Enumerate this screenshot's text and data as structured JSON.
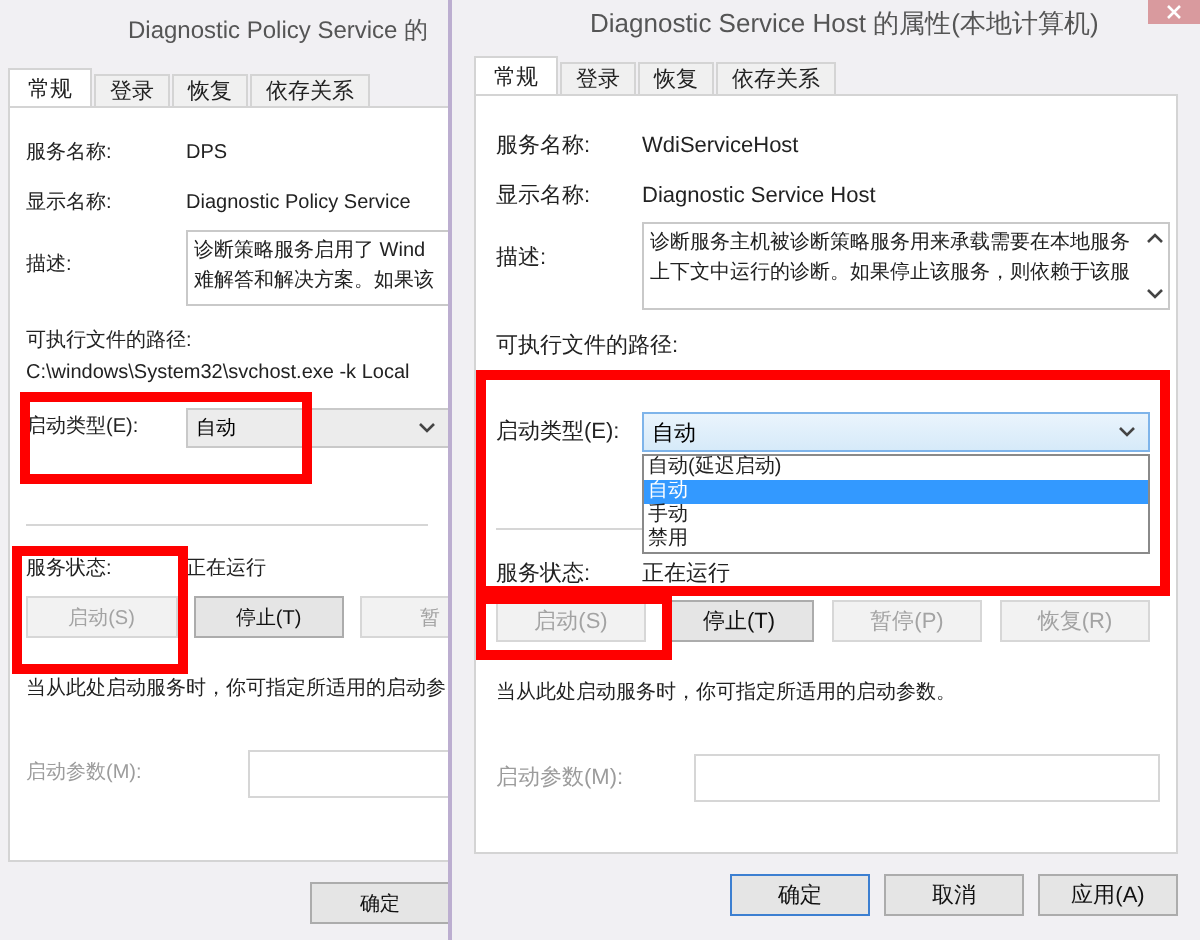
{
  "windows": [
    {
      "title": "Diagnostic Policy Service 的",
      "tabs": [
        {
          "label": "常规",
          "selected": true
        },
        {
          "label": "登录",
          "selected": false
        },
        {
          "label": "恢复",
          "selected": false
        },
        {
          "label": "依存关系",
          "selected": false
        }
      ],
      "service_name": {
        "label": "服务名称:",
        "value": "DPS"
      },
      "display_name": {
        "label": "显示名称:",
        "value": "Diagnostic Policy Service"
      },
      "description": {
        "label": "描述:",
        "lines": [
          "诊断策略服务启用了 Wind",
          "难解答和解决方案。如果该"
        ]
      },
      "path": {
        "label": "可执行文件的路径:",
        "value": "C:\\windows\\System32\\svchost.exe -k Local"
      },
      "startup_type": {
        "label": "启动类型(E):",
        "value": "自动",
        "expanded": false
      },
      "service_status": {
        "label": "服务状态:",
        "value": "正在运行"
      },
      "actions": [
        {
          "label": "启动(S)",
          "disabled": true
        },
        {
          "label": "停止(T)",
          "disabled": false
        },
        {
          "label": "暂",
          "disabled": true
        }
      ],
      "hint": "当从此处启动服务时，你可指定所适用的启动参",
      "parameters": {
        "label": "启动参数(M):",
        "disabled": true
      },
      "footer_buttons": [
        {
          "label": "确定",
          "default": false
        }
      ],
      "highlights": [
        {
          "kind": "startup"
        },
        {
          "kind": "status"
        }
      ]
    },
    {
      "title": "Diagnostic Service Host 的属性(本地计算机)",
      "close_button": true,
      "tabs": [
        {
          "label": "常规",
          "selected": true
        },
        {
          "label": "登录",
          "selected": false
        },
        {
          "label": "恢复",
          "selected": false
        },
        {
          "label": "依存关系",
          "selected": false
        }
      ],
      "service_name": {
        "label": "服务名称:",
        "value": "WdiServiceHost"
      },
      "display_name": {
        "label": "显示名称:",
        "value": "Diagnostic Service Host"
      },
      "description": {
        "label": "描述:",
        "lines": [
          "诊断服务主机被诊断策略服务用来承载需要在本地服务",
          "上下文中运行的诊断。如果停止该服务，则依赖于该服"
        ],
        "scrollbar": true
      },
      "path": {
        "label": "可执行文件的路径:"
      },
      "startup_type": {
        "label": "启动类型(E):",
        "value": "自动",
        "expanded": true,
        "options": [
          {
            "label": "自动(延迟启动)",
            "selected": false
          },
          {
            "label": "自动",
            "selected": true
          },
          {
            "label": "手动",
            "selected": false
          },
          {
            "label": "禁用",
            "selected": false
          }
        ]
      },
      "service_status": {
        "label": "服务状态:",
        "value": "正在运行"
      },
      "actions": [
        {
          "label": "启动(S)",
          "disabled": true
        },
        {
          "label": "停止(T)",
          "disabled": false
        },
        {
          "label": "暂停(P)",
          "disabled": true
        },
        {
          "label": "恢复(R)",
          "disabled": true
        }
      ],
      "hint": "当从此处启动服务时，你可指定所适用的启动参数。",
      "parameters": {
        "label": "启动参数(M):",
        "disabled": true
      },
      "footer_buttons": [
        {
          "label": "确定",
          "default": true
        },
        {
          "label": "取消",
          "default": false
        },
        {
          "label": "应用(A)",
          "default": false
        }
      ],
      "highlights": [
        {
          "kind": "startup"
        },
        {
          "kind": "start-button"
        }
      ]
    }
  ]
}
